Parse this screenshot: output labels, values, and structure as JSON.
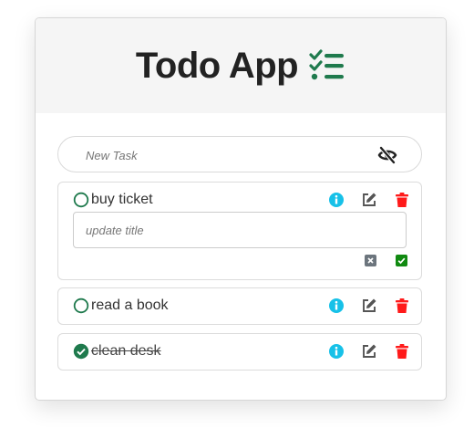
{
  "app": {
    "title": "Todo App"
  },
  "new_task": {
    "placeholder": "New Task"
  },
  "tasks": [
    {
      "title": "buy ticket",
      "completed": false,
      "editing": true,
      "update_placeholder": "update title"
    },
    {
      "title": "read a book",
      "completed": false,
      "editing": false
    },
    {
      "title": "clean desk",
      "completed": true,
      "editing": false
    }
  ],
  "colors": {
    "accent_green": "#1f7a4d",
    "info_blue": "#17c1e8",
    "delete_red": "#ff1a1a",
    "edit_gray": "#555555",
    "cancel_gray": "#6c757d",
    "confirm_green": "#118a11"
  },
  "icons": {
    "title": "checklist-icon",
    "visibility": "eye-slash-icon",
    "info": "info-circle-icon",
    "edit": "edit-icon",
    "delete": "trash-icon",
    "cancel": "close-square-icon",
    "confirm": "check-square-icon"
  }
}
